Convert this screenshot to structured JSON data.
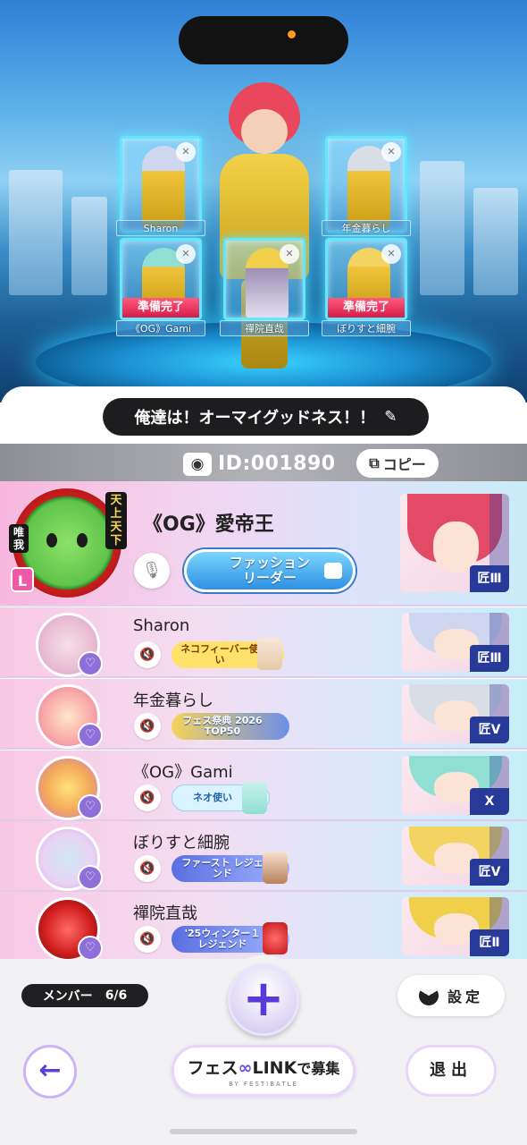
{
  "scene": {
    "slots": [
      {
        "name": "Sharon",
        "ready": ""
      },
      {
        "name": "年金暮らし",
        "ready": ""
      },
      {
        "name": "《OG》Gami",
        "ready": "準備完了"
      },
      {
        "name": "禪院直哉",
        "ready": ""
      },
      {
        "name": "ぼりすと細腕",
        "ready": "準備完了"
      }
    ]
  },
  "team": {
    "name": "俺達は！オーマイグッドネス！！"
  },
  "room": {
    "id": "ID:001890",
    "copy_label": "コピー"
  },
  "leader": {
    "name": "《OG》愛帝王",
    "badge": "L",
    "emblem_top": "天上天下",
    "emblem_left": "唯我",
    "title_line1": "ファッション",
    "title_line2": "リーダー",
    "rank": "匠Ⅲ"
  },
  "members": [
    {
      "name": "Sharon",
      "title": "ネコフィーバー使い",
      "rank": "匠Ⅲ",
      "hair": "#cfd6ef",
      "title_bg": "#ffe26b"
    },
    {
      "name": "年金暮らし",
      "title": "フェス祭典 2026 TOP50",
      "rank": "匠Ⅴ",
      "hair": "#d9dde6",
      "title_bg": "#bfe0ff"
    },
    {
      "name": "《OG》Gami",
      "title": "ネオ使い",
      "rank": "X",
      "hair": "#8fe0d2",
      "title_bg": "#d9f3ff"
    },
    {
      "name": "ぼりすと細腕",
      "title": "ファースト レジェンド",
      "rank": "匠Ⅴ",
      "hair": "#f3d462",
      "title_bg": "#b7c6ff"
    },
    {
      "name": "禪院直哉",
      "title": "'25ウィンター１ レジェンド",
      "rank": "匠Ⅱ",
      "hair": "#f0cf4a",
      "title_bg": "#b7c6ff"
    }
  ],
  "footer": {
    "member_label": "メンバー",
    "member_count": "6/6",
    "add_label": "+",
    "settings_label": "設定",
    "back_label": "←",
    "recruit_prefix": "フェス",
    "recruit_link": "LINK",
    "recruit_suffix": "で募集",
    "recruit_by": "BY FESTIBATLE",
    "exit_label": "退出"
  },
  "colors": {
    "accent": "#6b4ae0",
    "ready": "#e0265a",
    "leader_badge": "#ee5aa8"
  }
}
